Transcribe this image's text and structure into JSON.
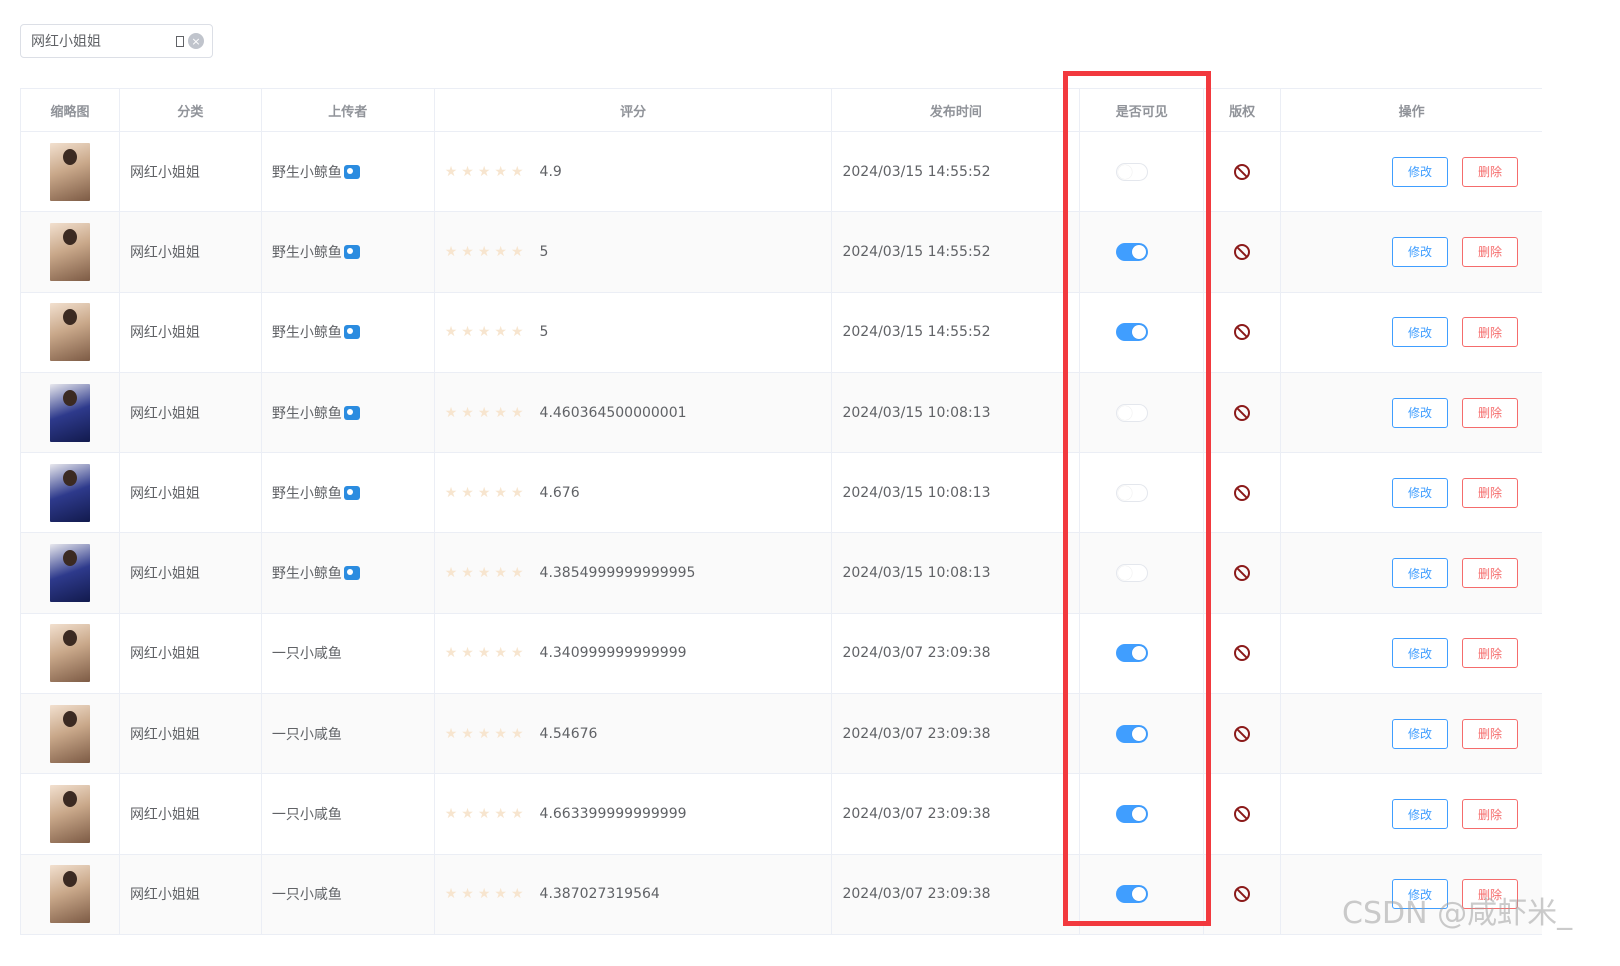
{
  "search": {
    "value": "网红小姐姐",
    "clear_icon": "clear-icon"
  },
  "table": {
    "headers": {
      "thumb": "缩略图",
      "category": "分类",
      "uploader": "上传者",
      "rating": "评分",
      "time": "发布时间",
      "visible": "是否可见",
      "copyright": "版权",
      "ops": "操作"
    },
    "edit_label": "修改",
    "delete_label": "删除",
    "rows": [
      {
        "category": "网红小姐姐",
        "uploader": "野生小鲸鱼",
        "uploader_icon": true,
        "rating": "4.9",
        "time": "2024/03/15 14:55:52",
        "visible": false,
        "dark": false
      },
      {
        "category": "网红小姐姐",
        "uploader": "野生小鲸鱼",
        "uploader_icon": true,
        "rating": "5",
        "time": "2024/03/15 14:55:52",
        "visible": true,
        "dark": false
      },
      {
        "category": "网红小姐姐",
        "uploader": "野生小鲸鱼",
        "uploader_icon": true,
        "rating": "5",
        "time": "2024/03/15 14:55:52",
        "visible": true,
        "dark": false
      },
      {
        "category": "网红小姐姐",
        "uploader": "野生小鲸鱼",
        "uploader_icon": true,
        "rating": "4.460364500000001",
        "time": "2024/03/15 10:08:13",
        "visible": false,
        "dark": true
      },
      {
        "category": "网红小姐姐",
        "uploader": "野生小鲸鱼",
        "uploader_icon": true,
        "rating": "4.676",
        "time": "2024/03/15 10:08:13",
        "visible": false,
        "dark": true
      },
      {
        "category": "网红小姐姐",
        "uploader": "野生小鲸鱼",
        "uploader_icon": true,
        "rating": "4.3854999999999995",
        "time": "2024/03/15 10:08:13",
        "visible": false,
        "dark": true
      },
      {
        "category": "网红小姐姐",
        "uploader": "一只小咸鱼",
        "uploader_icon": false,
        "rating": "4.340999999999999",
        "time": "2024/03/07 23:09:38",
        "visible": true,
        "dark": false
      },
      {
        "category": "网红小姐姐",
        "uploader": "一只小咸鱼",
        "uploader_icon": false,
        "rating": "4.54676",
        "time": "2024/03/07 23:09:38",
        "visible": true,
        "dark": false
      },
      {
        "category": "网红小姐姐",
        "uploader": "一只小咸鱼",
        "uploader_icon": false,
        "rating": "4.663399999999999",
        "time": "2024/03/07 23:09:38",
        "visible": true,
        "dark": false
      },
      {
        "category": "网红小姐姐",
        "uploader": "一只小咸鱼",
        "uploader_icon": false,
        "rating": "4.387027319564",
        "time": "2024/03/07 23:09:38",
        "visible": true,
        "dark": false
      }
    ]
  },
  "watermark": "CSDN @咸虾米_",
  "colors": {
    "primary": "#409eff",
    "danger": "#f56c6c",
    "highlight_frame": "#f2393e",
    "ban_icon": "#8b1a1a"
  }
}
